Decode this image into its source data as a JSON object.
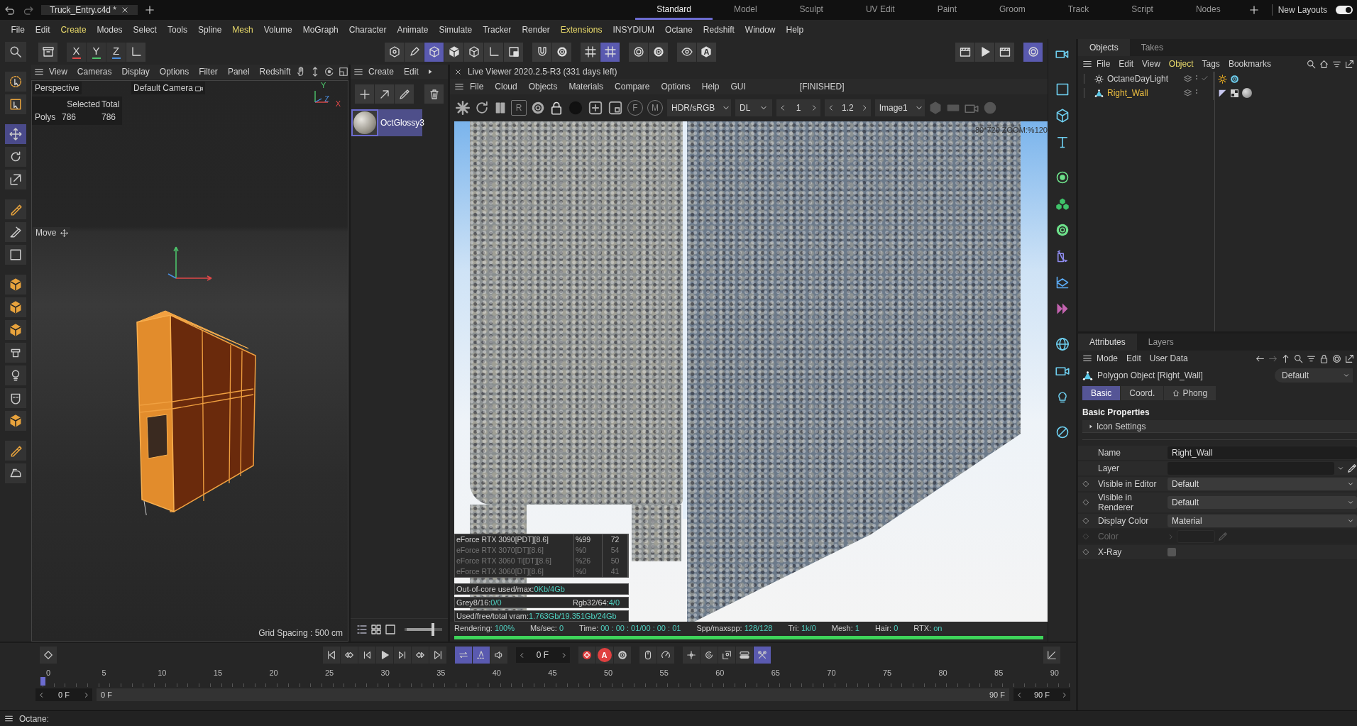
{
  "title_bar": {
    "file_tabs": [
      {
        "label": "Truck_Entry.c4d *",
        "selected": true
      }
    ],
    "layouts": [
      {
        "label": "Standard",
        "selected": true
      },
      {
        "label": "Model",
        "selected": false
      },
      {
        "label": "Sculpt",
        "selected": false
      },
      {
        "label": "UV Edit",
        "selected": false
      },
      {
        "label": "Paint",
        "selected": false
      },
      {
        "label": "Groom",
        "selected": false
      },
      {
        "label": "Track",
        "selected": false
      },
      {
        "label": "Script",
        "selected": false
      },
      {
        "label": "Nodes",
        "selected": false
      }
    ],
    "new_layouts": "New Layouts",
    "new_layouts_toggle": {
      "on": true
    }
  },
  "menu": [
    {
      "label": "File",
      "highlighted": false
    },
    {
      "label": "Edit",
      "highlighted": false
    },
    {
      "label": "Create",
      "highlighted": true
    },
    {
      "label": "Modes",
      "highlighted": false
    },
    {
      "label": "Select",
      "highlighted": false
    },
    {
      "label": "Tools",
      "highlighted": false
    },
    {
      "label": "Spline",
      "highlighted": false
    },
    {
      "label": "Mesh",
      "highlighted": true
    },
    {
      "label": "Volume",
      "highlighted": false
    },
    {
      "label": "MoGraph",
      "highlighted": false
    },
    {
      "label": "Character",
      "highlighted": false
    },
    {
      "label": "Animate",
      "highlighted": false
    },
    {
      "label": "Simulate",
      "highlighted": false
    },
    {
      "label": "Tracker",
      "highlighted": false
    },
    {
      "label": "Render",
      "highlighted": false
    },
    {
      "label": "Extensions",
      "highlighted": true
    },
    {
      "label": "INSYDIUM",
      "highlighted": false
    },
    {
      "label": "Octane",
      "highlighted": false
    },
    {
      "label": "Redshift",
      "highlighted": false
    },
    {
      "label": "Window",
      "highlighted": false
    },
    {
      "label": "Help",
      "highlighted": false
    }
  ],
  "toolbar": {
    "axis_buttons": [
      {
        "label": "X",
        "color": "#e04848"
      },
      {
        "label": "Y",
        "color": "#4cc36a"
      },
      {
        "label": "Z",
        "color": "#4a8fe0"
      }
    ],
    "letter_icon": "A"
  },
  "viewport": {
    "menu": [
      "View",
      "Cameras",
      "Display",
      "Options",
      "Filter",
      "Panel",
      "Redshift"
    ],
    "camera": "Perspective",
    "camera_name": "Default Camera",
    "stats_headers": [
      "Selected",
      "Total"
    ],
    "stats_label": "Polys",
    "stats_values": [
      "786",
      "786"
    ],
    "axis_labels": [
      "Y",
      "Z",
      "X"
    ],
    "tool_label": "Move",
    "grid_spacing": "Grid Spacing : 500 cm"
  },
  "materials": {
    "menu": [
      "Create",
      "Edit"
    ],
    "items": [
      {
        "name": "OctGlossy3",
        "selected": true
      }
    ],
    "zoom_slider": {
      "level": 0.85
    }
  },
  "live_viewer": {
    "title": "Live Viewer 2020.2.5-R3 (331 days left)",
    "menu": [
      "File",
      "Cloud",
      "Objects",
      "Materials",
      "Compare",
      "Options",
      "Help",
      "GUI"
    ],
    "status": "[FINISHED]",
    "letter_buttons": [
      "R",
      "F",
      "M"
    ],
    "color_space": "HDR/sRGB",
    "mode": "DL",
    "stepper_1": "1",
    "stepper_2": "1.2",
    "image": "Image1",
    "zoom_info": "80*720 ZOOM:%120",
    "gpus": [
      {
        "name": "eForce RTX 3090[PDT][8.6]",
        "load": "%99",
        "temp": "72",
        "active": true
      },
      {
        "name": "eForce RTX 3070[DT][8.6]",
        "load": "%0",
        "temp": "54",
        "active": false
      },
      {
        "name": "eForce RTX 3060 Ti[DT][8.6]",
        "load": "%26",
        "temp": "50",
        "active": false
      },
      {
        "name": "eForce RTX 3060[DT][8.6]",
        "load": "%0",
        "temp": "41",
        "active": false
      }
    ],
    "memory": [
      [
        {
          "label": "Out-of-core used/max:",
          "value": "0Kb/4Gb"
        }
      ],
      [
        {
          "label": "Grey8/16:",
          "value": "0/0"
        },
        {
          "label": "Rgb32/64:",
          "value": "4/0"
        }
      ],
      [
        {
          "label": "Used/free/total vram:",
          "value": "1.763Gb/19.351Gb/24Gb"
        }
      ]
    ],
    "render_stats": [
      {
        "label": "Rendering:",
        "value": "100%"
      },
      {
        "label": "Ms/sec:",
        "value": "0"
      },
      {
        "label": "Time:",
        "value": "00 : 00 : 01/00 : 00 : 01"
      },
      {
        "label": "Spp/maxspp:",
        "value": "128/128"
      },
      {
        "label": "Tri:",
        "value": "1k/0"
      },
      {
        "label": "Mesh:",
        "value": "1"
      },
      {
        "label": "Hair:",
        "value": "0"
      },
      {
        "label": "RTX:",
        "value": "on"
      }
    ],
    "progress": {
      "level": 1
    }
  },
  "objects": {
    "tabs": [
      {
        "label": "Objects",
        "selected": true
      },
      {
        "label": "Takes",
        "selected": false
      }
    ],
    "menu": [
      {
        "label": "File",
        "highlighted": false
      },
      {
        "label": "Edit",
        "highlighted": false
      },
      {
        "label": "View",
        "highlighted": false
      },
      {
        "label": "Object",
        "highlighted": true
      },
      {
        "label": "Tags",
        "highlighted": false
      },
      {
        "label": "Bookmarks",
        "highlighted": false
      }
    ],
    "items": [
      {
        "name": "OctaneDayLight",
        "kind": "light",
        "selected": false
      },
      {
        "name": "Right_Wall",
        "kind": "polygon",
        "selected": true
      }
    ]
  },
  "attributes": {
    "tabs": [
      {
        "label": "Attributes",
        "selected": true
      },
      {
        "label": "Layers",
        "selected": false
      }
    ],
    "menu": [
      "Mode",
      "Edit",
      "User Data"
    ],
    "object_title": "Polygon Object [Right_Wall]",
    "preset": "Default",
    "sub_tabs": [
      {
        "label": "Basic",
        "selected": true
      },
      {
        "label": "Coord.",
        "selected": false
      },
      {
        "label": "Phong",
        "selected": false
      }
    ],
    "section": "Basic Properties",
    "group": {
      "label": "Icon Settings",
      "expanded": false
    },
    "fields": [
      {
        "kind": "text",
        "label": "Name",
        "value": "Right_Wall",
        "keyframe": false,
        "disabled": false
      },
      {
        "kind": "layer",
        "label": "Layer",
        "keyframe": false,
        "disabled": false
      },
      {
        "kind": "dropdown",
        "label": "Visible in Editor",
        "value": "Default",
        "keyframe": true,
        "disabled": false
      },
      {
        "kind": "dropdown",
        "label": "Visible in Renderer",
        "value": "Default",
        "keyframe": true,
        "disabled": false
      },
      {
        "kind": "dropdown",
        "label": "Display Color",
        "value": "Material",
        "keyframe": true,
        "disabled": false
      },
      {
        "kind": "color",
        "label": "Color",
        "keyframe": true,
        "disabled": true
      },
      {
        "kind": "checkbox",
        "label": "X-Ray",
        "checked": false,
        "keyframe": true,
        "disabled": false
      }
    ]
  },
  "timeline": {
    "frame": "0 F",
    "autokey_letter": "A",
    "ruler": [
      "0",
      "5",
      "10",
      "15",
      "20",
      "25",
      "30",
      "35",
      "40",
      "45",
      "50",
      "55",
      "60",
      "65",
      "70",
      "75",
      "80",
      "85",
      "90"
    ],
    "start": "0 F",
    "range_start": "0 F",
    "range_end": "90 F",
    "end": "90 F"
  },
  "status_bar": "Octane:"
}
